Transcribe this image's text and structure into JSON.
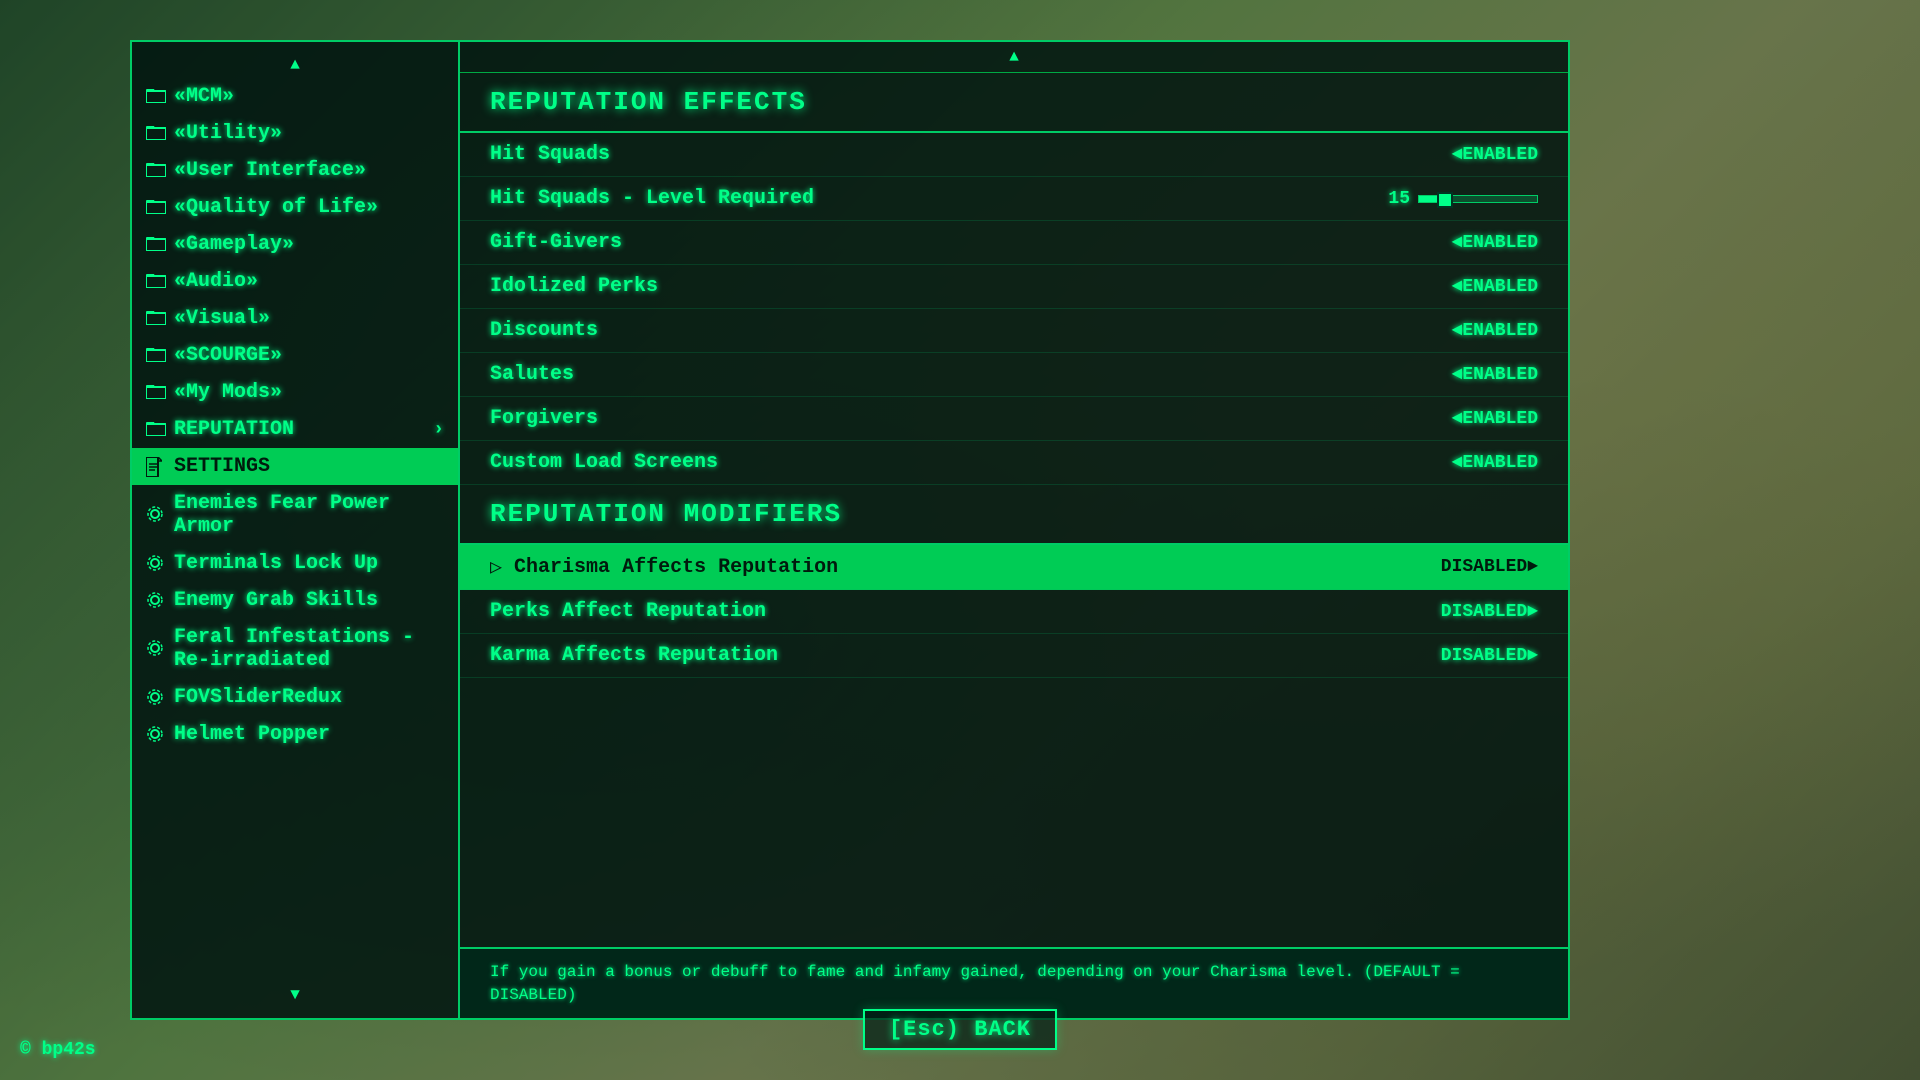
{
  "background": {
    "color": "#2a3a1a"
  },
  "copyright": "© bp42s",
  "back_button": "[Esc) BACK",
  "sidebar": {
    "scroll_up_icon": "▲",
    "scroll_down_icon": "▼",
    "items": [
      {
        "id": "mcm",
        "label": "«MCM»",
        "icon": "folder",
        "active": false
      },
      {
        "id": "utility",
        "label": "«Utility»",
        "icon": "folder",
        "active": false
      },
      {
        "id": "user-interface",
        "label": "«User Interface»",
        "icon": "folder",
        "active": false
      },
      {
        "id": "quality-of-life",
        "label": "«Quality of Life»",
        "icon": "folder",
        "active": false
      },
      {
        "id": "gameplay",
        "label": "«Gameplay»",
        "icon": "folder",
        "active": false
      },
      {
        "id": "audio",
        "label": "«Audio»",
        "icon": "folder",
        "active": false
      },
      {
        "id": "visual",
        "label": "«Visual»",
        "icon": "folder",
        "active": false
      },
      {
        "id": "scourge",
        "label": "«SCOURGE»",
        "icon": "folder",
        "active": false
      },
      {
        "id": "my-mods",
        "label": "«My Mods»",
        "icon": "folder",
        "active": false
      },
      {
        "id": "reputation",
        "label": "REPUTATION",
        "icon": "folder",
        "active": false,
        "arrow": "›"
      },
      {
        "id": "settings",
        "label": "SETTINGS",
        "icon": "page",
        "active": true
      },
      {
        "id": "enemies-fear",
        "label": "Enemies Fear Power Armor",
        "icon": "gear",
        "active": false
      },
      {
        "id": "terminals-lock-up",
        "label": "Terminals Lock Up",
        "icon": "gear",
        "active": false
      },
      {
        "id": "enemy-grab-skills",
        "label": "Enemy Grab Skills",
        "icon": "gear",
        "active": false
      },
      {
        "id": "feral-infestations",
        "label": "Feral Infestations - Re-irradiated",
        "icon": "gear",
        "active": false
      },
      {
        "id": "fov-slider-redux",
        "label": "FOVSliderRedux",
        "icon": "gear",
        "active": false
      },
      {
        "id": "helmet-popper",
        "label": "Helmet Popper",
        "icon": "gear",
        "active": false
      }
    ]
  },
  "right_panel": {
    "scroll_up_icon": "▲",
    "scroll_down_icon": "▼",
    "sections": [
      {
        "id": "reputation-effects",
        "title": "REPUTATION EFFECTS",
        "settings": [
          {
            "id": "hit-squads",
            "label": "Hit Squads",
            "value": "◄ENABLED",
            "type": "toggle",
            "highlighted": false
          },
          {
            "id": "hit-squads-level",
            "label": "Hit Squads - Level Required",
            "value": "",
            "type": "slider",
            "slider_num": "15",
            "slider_pct": 15,
            "highlighted": false
          },
          {
            "id": "gift-givers",
            "label": "Gift-Givers",
            "value": "◄ENABLED",
            "type": "toggle",
            "highlighted": false
          },
          {
            "id": "idolized-perks",
            "label": "Idolized Perks",
            "value": "◄ENABLED",
            "type": "toggle",
            "highlighted": false
          },
          {
            "id": "discounts",
            "label": "Discounts",
            "value": "◄ENABLED",
            "type": "toggle",
            "highlighted": false
          },
          {
            "id": "salutes",
            "label": "Salutes",
            "value": "◄ENABLED",
            "type": "toggle",
            "highlighted": false
          },
          {
            "id": "forgivers",
            "label": "Forgivers",
            "value": "◄ENABLED",
            "type": "toggle",
            "highlighted": false
          },
          {
            "id": "custom-load-screens",
            "label": "Custom Load Screens",
            "value": "◄ENABLED",
            "type": "toggle",
            "highlighted": false
          }
        ]
      },
      {
        "id": "reputation-modifiers",
        "title": "REPUTATION MODIFIERS",
        "settings": [
          {
            "id": "charisma-affects",
            "label": "Charisma Affects Reputation",
            "value": "DISABLED►",
            "type": "toggle",
            "highlighted": true
          },
          {
            "id": "perks-affect",
            "label": "Perks Affect Reputation",
            "value": "DISABLED►",
            "type": "toggle",
            "highlighted": false
          },
          {
            "id": "karma-affects",
            "label": "Karma Affects Reputation",
            "value": "DISABLED►",
            "type": "toggle",
            "highlighted": false
          }
        ]
      }
    ],
    "description": "If you gain a bonus or debuff to fame and infamy gained, depending on your Charisma level. (DEFAULT = DISABLED)"
  }
}
